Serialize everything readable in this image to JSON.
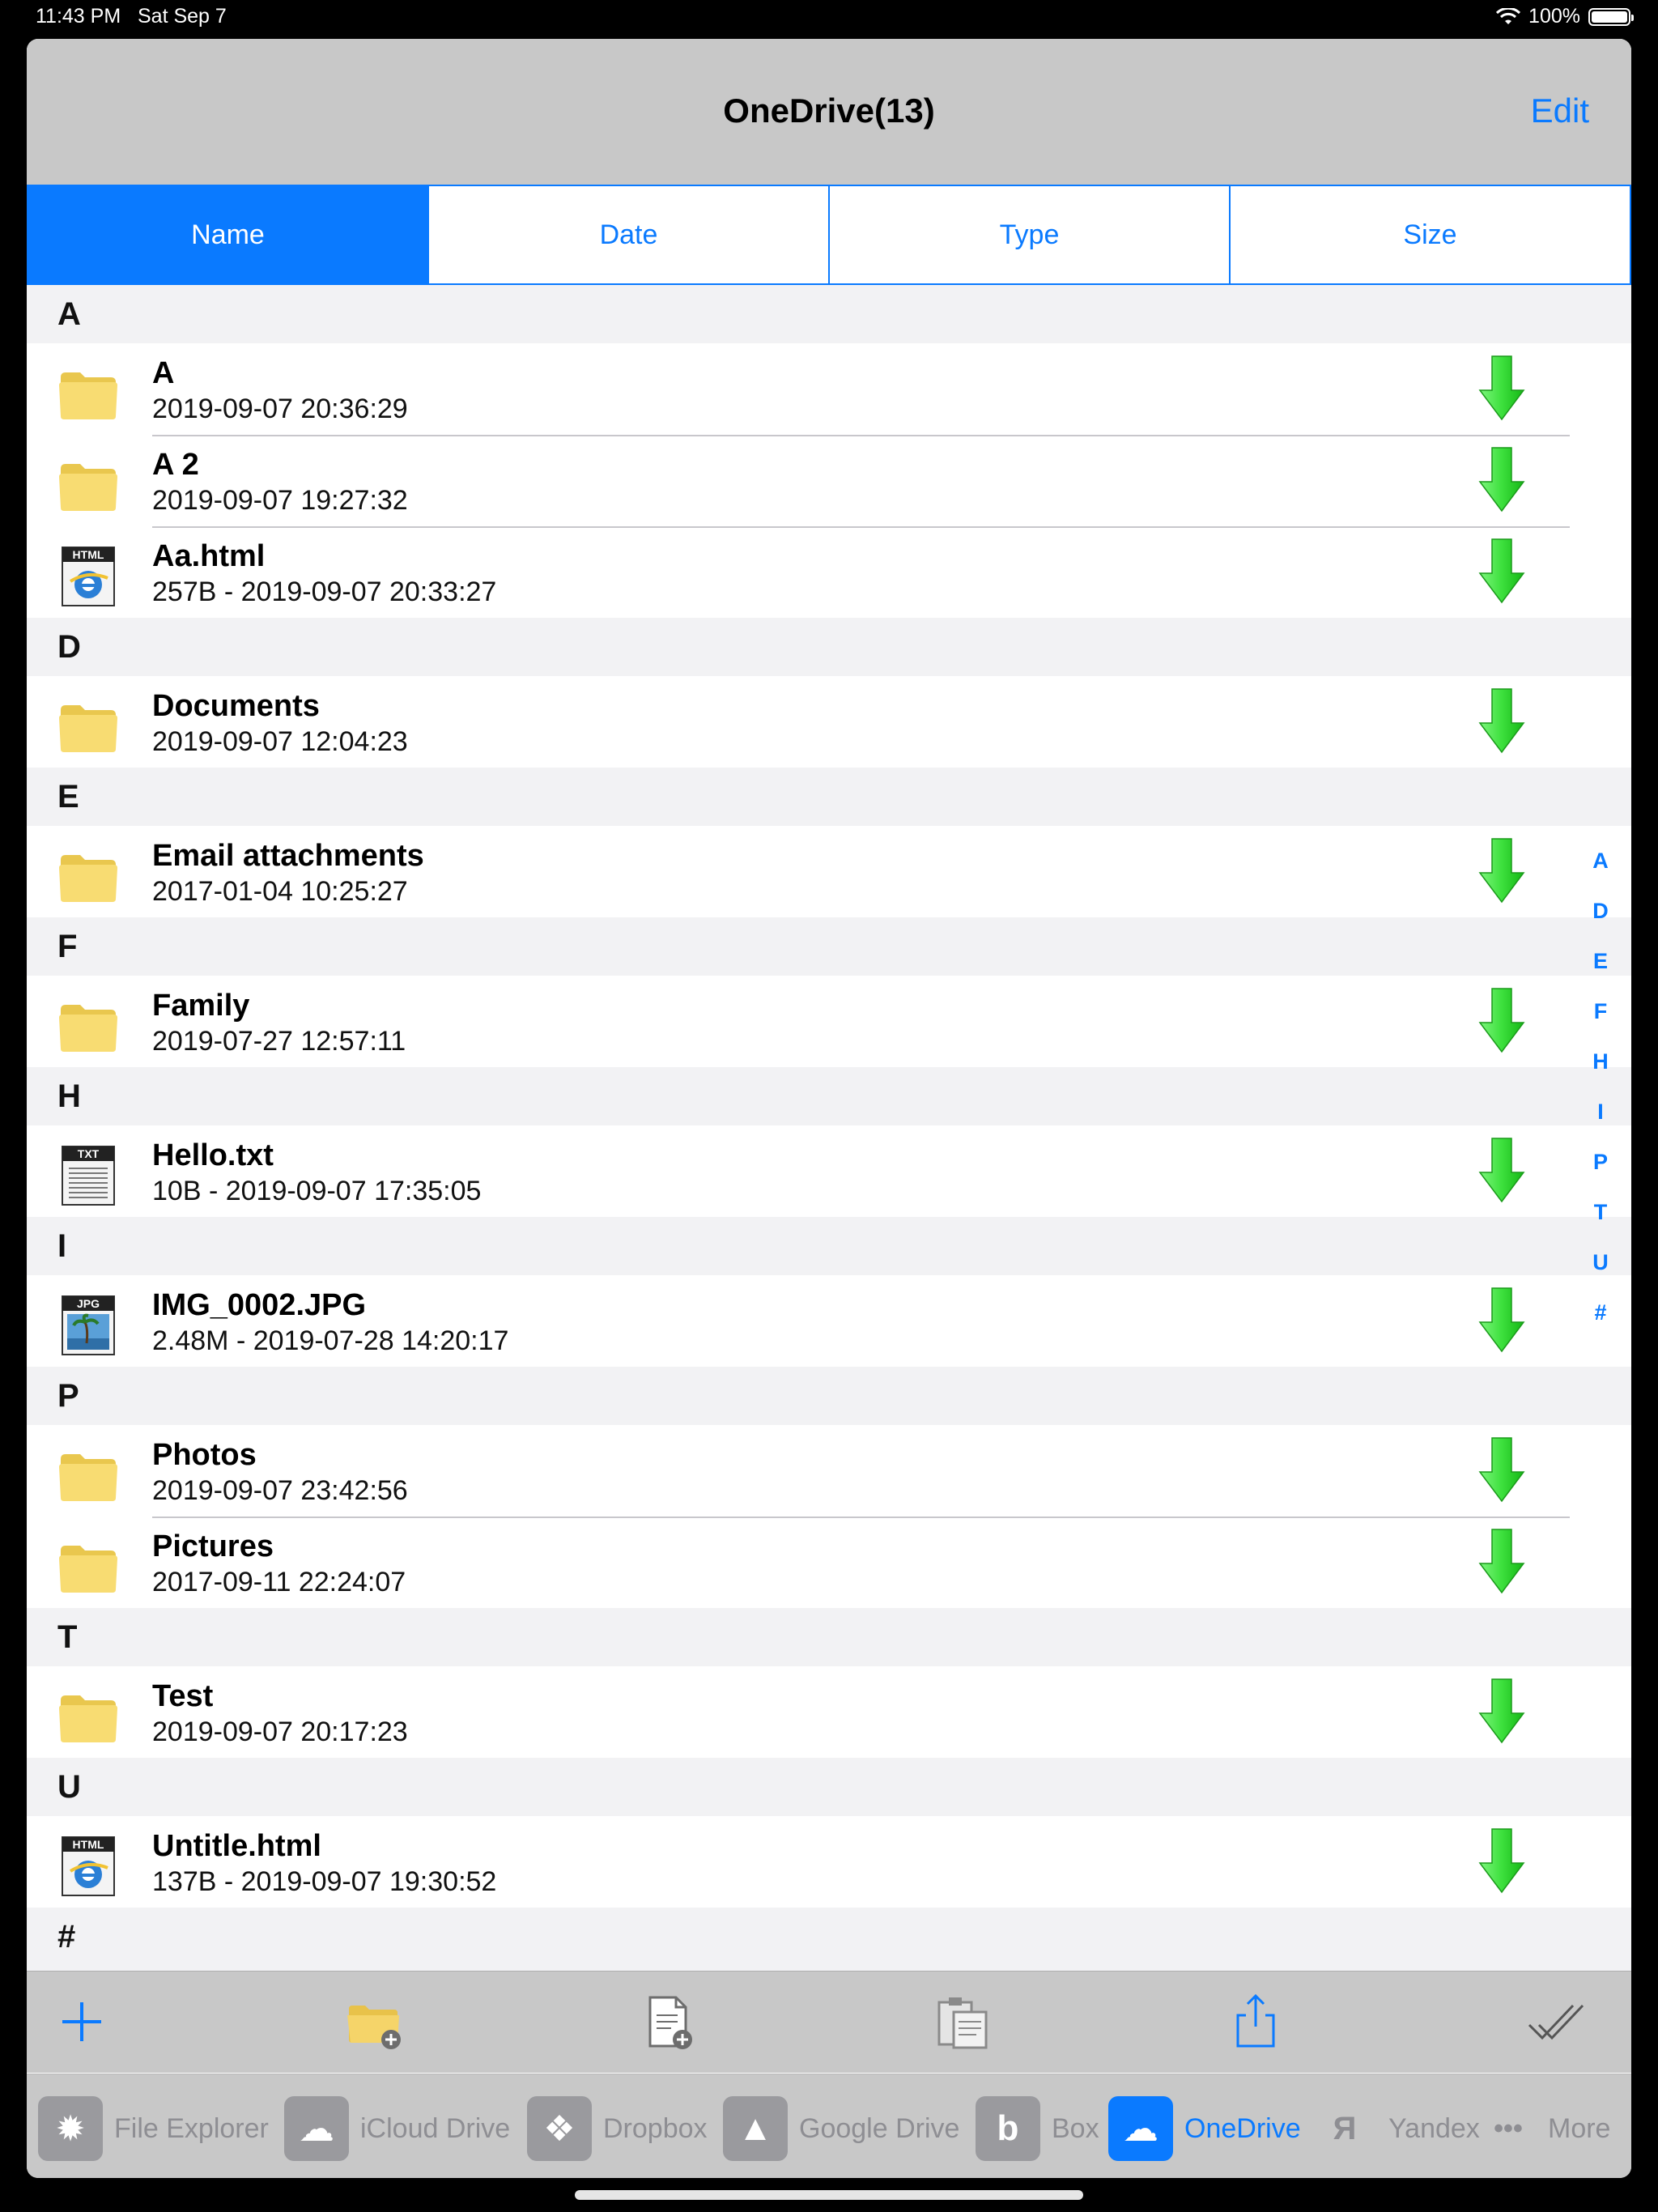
{
  "status": {
    "time": "11:43 PM",
    "date": "Sat Sep 7",
    "battery": "100%"
  },
  "nav": {
    "title": "OneDrive(13)",
    "edit_label": "Edit"
  },
  "sort_tabs": [
    {
      "label": "Name",
      "active": true
    },
    {
      "label": "Date",
      "active": false
    },
    {
      "label": "Type",
      "active": false
    },
    {
      "label": "Size",
      "active": false
    }
  ],
  "sections": [
    {
      "header": "A",
      "rows": [
        {
          "icon": "folder-icon",
          "name": "A",
          "sub": "2019-09-07 20:36:29"
        },
        {
          "icon": "folder-icon",
          "name": "A 2",
          "sub": "2019-09-07 19:27:32"
        },
        {
          "icon": "html-file-icon",
          "name": "Aa.html",
          "sub": "257B - 2019-09-07 20:33:27"
        }
      ]
    },
    {
      "header": "D",
      "rows": [
        {
          "icon": "folder-icon",
          "name": "Documents",
          "sub": "2019-09-07 12:04:23"
        }
      ]
    },
    {
      "header": "E",
      "rows": [
        {
          "icon": "folder-icon",
          "name": "Email attachments",
          "sub": "2017-01-04 10:25:27"
        }
      ]
    },
    {
      "header": "F",
      "rows": [
        {
          "icon": "folder-icon",
          "name": "Family",
          "sub": "2019-07-27 12:57:11"
        }
      ]
    },
    {
      "header": "H",
      "rows": [
        {
          "icon": "txt-file-icon",
          "name": "Hello.txt",
          "sub": "10B - 2019-09-07 17:35:05"
        }
      ]
    },
    {
      "header": "I",
      "rows": [
        {
          "icon": "jpg-file-icon",
          "name": "IMG_0002.JPG",
          "sub": "2.48M - 2019-07-28 14:20:17"
        }
      ]
    },
    {
      "header": "P",
      "rows": [
        {
          "icon": "folder-icon",
          "name": "Photos",
          "sub": "2019-09-07 23:42:56"
        },
        {
          "icon": "folder-icon",
          "name": "Pictures",
          "sub": "2017-09-11 22:24:07"
        }
      ]
    },
    {
      "header": "T",
      "rows": [
        {
          "icon": "folder-icon",
          "name": "Test",
          "sub": "2019-09-07 20:17:23"
        }
      ]
    },
    {
      "header": "U",
      "rows": [
        {
          "icon": "html-file-icon",
          "name": "Untitle.html",
          "sub": "137B - 2019-09-07 19:30:52"
        }
      ]
    },
    {
      "header": "#",
      "rows": []
    }
  ],
  "index": [
    "A",
    "D",
    "E",
    "F",
    "H",
    "I",
    "P",
    "T",
    "U",
    "#"
  ],
  "icon_labels": {
    "html": "HTML",
    "txt": "TXT",
    "jpg": "JPG"
  },
  "toolbar": [
    {
      "icon": "plus-icon"
    },
    {
      "icon": "new-folder-icon"
    },
    {
      "icon": "new-file-icon"
    },
    {
      "icon": "paste-icon"
    },
    {
      "icon": "share-icon"
    },
    {
      "icon": "select-all-icon"
    }
  ],
  "tabs": [
    {
      "label": "File Explorer",
      "icon": "file-explorer-icon",
      "active": false
    },
    {
      "label": "iCloud Drive",
      "icon": "icloud-icon",
      "active": false
    },
    {
      "label": "Dropbox",
      "icon": "dropbox-icon",
      "active": false
    },
    {
      "label": "Google Drive",
      "icon": "google-drive-icon",
      "active": false
    },
    {
      "label": "Box",
      "icon": "box-icon",
      "active": false
    },
    {
      "label": "OneDrive",
      "icon": "onedrive-icon",
      "active": true
    },
    {
      "label": "Yandex",
      "icon": "yandex-icon",
      "active": false
    },
    {
      "label": "More",
      "icon": "more-icon",
      "active": false
    }
  ],
  "colors": {
    "accent": "#0a7aff",
    "download": "#2ecc2e",
    "folder": "#f6d86b"
  }
}
